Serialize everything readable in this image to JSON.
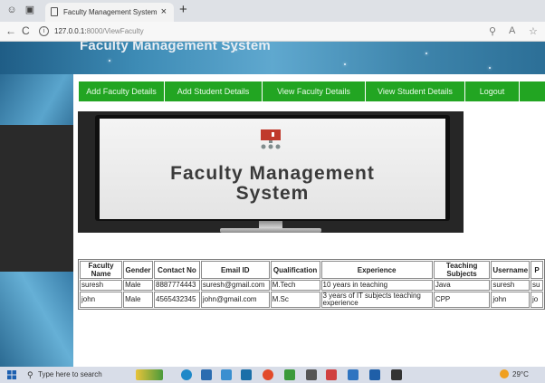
{
  "browser": {
    "tab_title": "Faculty Management System",
    "tab_close": "×",
    "new_tab": "+",
    "back": "←",
    "reload": "C",
    "url_host": "127.0.0.1:",
    "url_rest": "8000/ViewFaculty"
  },
  "site": {
    "title": "Faculty Management System"
  },
  "nav": {
    "items": [
      "Add Faculty Details",
      "Add Student Details",
      "View Faculty Details",
      "View Student Details",
      "Logout"
    ]
  },
  "hero": {
    "line1": "Faculty Management",
    "line2": "System"
  },
  "table": {
    "headers": [
      "Faculty Name",
      "Gender",
      "Contact No",
      "Email ID",
      "Qualification",
      "Experience",
      "Teaching Subjects",
      "Username",
      "P"
    ],
    "rows": [
      [
        "suresh",
        "Male",
        "8887774443",
        "suresh@gmail.com",
        "M.Tech",
        "10 years in teaching",
        "Java",
        "suresh",
        "su"
      ],
      [
        "john",
        "Male",
        "4565432345",
        "john@gmail.com",
        "M.Sc",
        "3 years of IT subjects teaching experience",
        "CPP",
        "john",
        "jo"
      ]
    ]
  },
  "taskbar": {
    "search_placeholder": "Type here to search",
    "temperature": "29°C"
  },
  "icons": [
    "windows-icon",
    "search-icon",
    "info-icon",
    "page-icon",
    "monitor-icon",
    "weather-icon"
  ]
}
